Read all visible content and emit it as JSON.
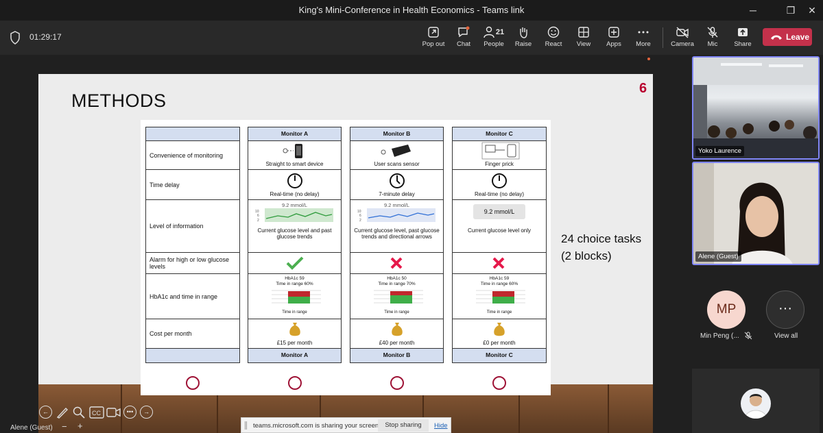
{
  "window": {
    "title": "King's Mini-Conference in Health Economics - Teams link",
    "min": "─",
    "max": "❐",
    "close": "✕"
  },
  "meeting": {
    "elapsed": "01:29:17"
  },
  "toolbar": {
    "popout": "Pop out",
    "chat": "Chat",
    "people": "People",
    "people_count": "21",
    "raise": "Raise",
    "react": "React",
    "view": "View",
    "apps": "Apps",
    "more": "More",
    "camera": "Camera",
    "mic": "Mic",
    "share": "Share",
    "leave": "Leave"
  },
  "slide": {
    "title": "METHODS",
    "number": "6",
    "choice_tasks": "24 choice tasks (2 blocks)",
    "attributes": [
      "Convenience of monitoring",
      "Time delay",
      "Level of information",
      "Alarm for high or low glucose levels",
      "HbA1c and time in range",
      "Cost per month"
    ],
    "monitors": [
      {
        "name": "Monitor A",
        "convenience": "Straight to smart device",
        "delay": "Real-time (no delay)",
        "info_value": "9.2 mmol/L",
        "info": "Current glucose level and past glucose trends",
        "alarm": "yes",
        "hba1c": "HbA1c 59",
        "tir": "Time in range 60%",
        "tir_axis": "Time in range",
        "cost": "£15 per month"
      },
      {
        "name": "Monitor B",
        "convenience": "User scans sensor",
        "delay": "7-minute delay",
        "info_value": "9.2 mmol/L",
        "info": "Current glucose level, past glucose trends and directional arrows",
        "alarm": "no",
        "hba1c": "HbA1c 50",
        "tir": "Time in range 70%",
        "tir_axis": "Time in range",
        "cost": "£40 per month"
      },
      {
        "name": "Monitor C",
        "convenience": "Finger prick",
        "delay": "Real-time (no delay)",
        "info_value": "9.2 mmol/L",
        "info": "Current glucose level only",
        "alarm": "no",
        "hba1c": "HbA1c 59",
        "tir": "Time in range 60%",
        "tir_axis": "Time in range",
        "cost": "£0 per month"
      }
    ]
  },
  "presenter_bar": {
    "name": "Alene (Guest)",
    "zoom_out": "−",
    "zoom_in": "+"
  },
  "sharing": {
    "message": "teams.microsoft.com is sharing your screen.",
    "stop": "Stop sharing",
    "hide": "Hide"
  },
  "participants": [
    {
      "name": "Yoko Laurence"
    },
    {
      "name": "Alene (Guest)"
    },
    {
      "name": "Min Peng (...",
      "initials": "MP"
    }
  ],
  "view_all": "View all",
  "colors": {
    "accent": "#7f85f5",
    "leave": "#c4314b",
    "ring": "#9e1235",
    "check": "#4caf50",
    "cross": "#e6194b"
  }
}
